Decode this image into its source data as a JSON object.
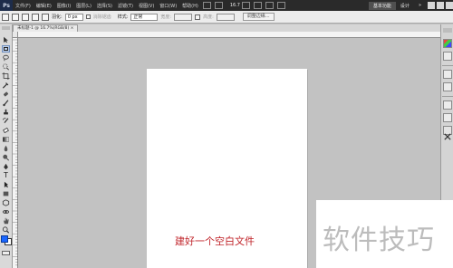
{
  "app": {
    "logo": "Ps",
    "menu": [
      "文件(F)",
      "编辑(E)",
      "图像(I)",
      "图层(L)",
      "选择(S)",
      "滤镜(T)",
      "视图(V)",
      "窗口(W)",
      "帮助(H)"
    ],
    "zoom": "16.7",
    "workspace_buttons": [
      "基本功能",
      "设计"
    ]
  },
  "options": {
    "feather_label": "羽化:",
    "feather_value": "0 px",
    "antialias_label": "消除锯齿",
    "style_label": "样式:",
    "style_value": "正常",
    "width_label": "宽度:",
    "height_label": "高度:",
    "refine_button": "调整边缘..."
  },
  "document": {
    "tab_title": "未标题-1 @ 16.7%(RGB/8) ×",
    "canvas_text": "建好一个空白文件"
  },
  "ruler_top_ticks": [
    "2800",
    "2600",
    "2400",
    "2200",
    "2000",
    "1800",
    "1600",
    "1400",
    "1200",
    "1000",
    "800",
    "600",
    "400",
    "200",
    "0",
    "200",
    "400",
    "600",
    "800",
    "1000",
    "1200",
    "1400",
    "1600",
    "1800",
    "2000",
    "2200",
    "2400",
    "2600",
    "2800",
    "3000",
    "3200",
    "3400",
    "3600",
    "3800",
    "4000",
    "4200",
    "4400"
  ],
  "watermark": {
    "text": "软件技巧"
  },
  "colors": {
    "canvas_text": "#c0242a",
    "menubar": "#2a2a2a",
    "workspace_bg": "#c2c2c2"
  }
}
